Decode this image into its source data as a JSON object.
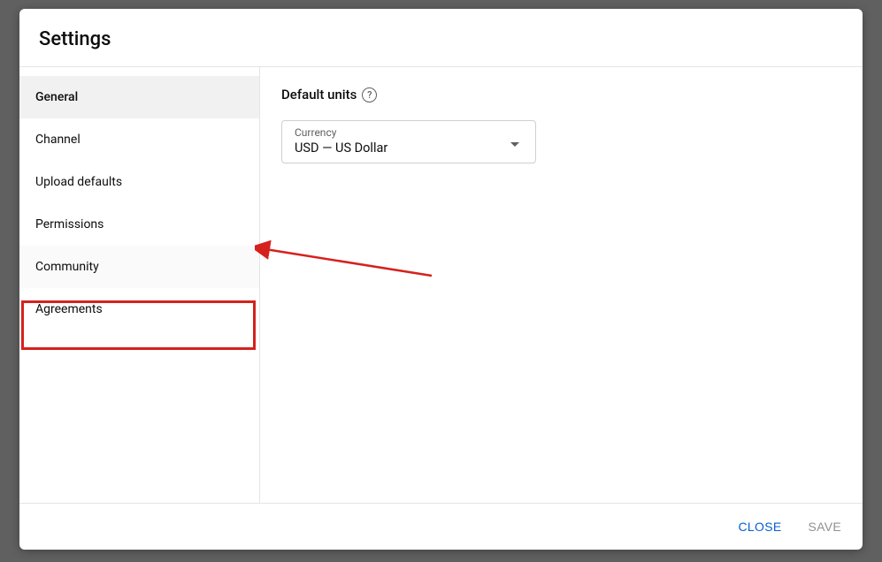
{
  "dialog": {
    "title": "Settings"
  },
  "sidebar": {
    "items": [
      {
        "label": "General"
      },
      {
        "label": "Channel"
      },
      {
        "label": "Upload defaults"
      },
      {
        "label": "Permissions"
      },
      {
        "label": "Community"
      },
      {
        "label": "Agreements"
      }
    ]
  },
  "main": {
    "section_title": "Default units",
    "help_glyph": "?",
    "currency": {
      "label": "Currency",
      "value": "USD — US Dollar"
    }
  },
  "footer": {
    "close": "CLOSE",
    "save": "SAVE"
  },
  "annotation": {
    "highlighted_item": "Community"
  }
}
